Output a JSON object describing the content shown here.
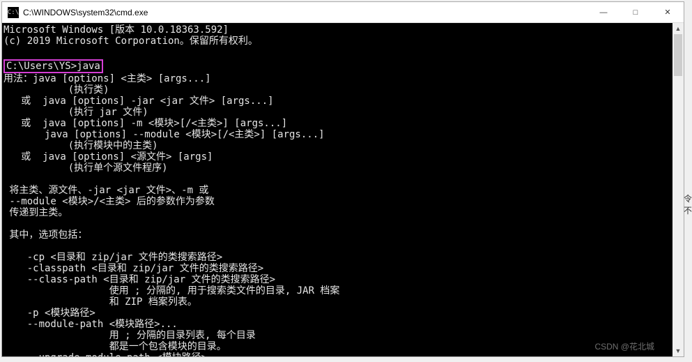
{
  "window": {
    "icon_label": "C:\\",
    "title": "C:\\WINDOWS\\system32\\cmd.exe"
  },
  "controls": {
    "minimize": "—",
    "maximize": "□",
    "close": "✕"
  },
  "terminal": {
    "header1": "Microsoft Windows [版本 10.0.18363.592]",
    "header2": "(c) 2019 Microsoft Corporation。保留所有权利。",
    "prompt": "C:\\Users\\YS>java",
    "body": "用法：java [options] <主类> [args...]\n           (执行类)\n   或  java [options] -jar <jar 文件> [args...]\n           (执行 jar 文件)\n   或  java [options] -m <模块>[/<主类>] [args...]\n       java [options] --module <模块>[/<主类>] [args...]\n           (执行模块中的主类)\n   或  java [options] <源文件> [args]\n           (执行单个源文件程序)\n\n 将主类、源文件、-jar <jar 文件>、-m 或\n --module <模块>/<主类> 后的参数作为参数\n 传递到主类。\n\n 其中，选项包括：\n\n    -cp <目录和 zip/jar 文件的类搜索路径>\n    -classpath <目录和 zip/jar 文件的类搜索路径>\n    --class-path <目录和 zip/jar 文件的类搜索路径>\n                  使用 ; 分隔的, 用于搜索类文件的目录, JAR 档案\n                  和 ZIP 档案列表。\n    -p <模块路径>\n    --module-path <模块路径>...\n                  用 ; 分隔的目录列表, 每个目录\n                  都是一个包含模块的目录。\n    --upgrade-module-path <模块路径>..."
  },
  "scrollbar": {
    "up": "▲",
    "down": "▼"
  },
  "watermark": "CSDN @花北城",
  "outside": {
    "char1": "令",
    "char2": "不"
  }
}
